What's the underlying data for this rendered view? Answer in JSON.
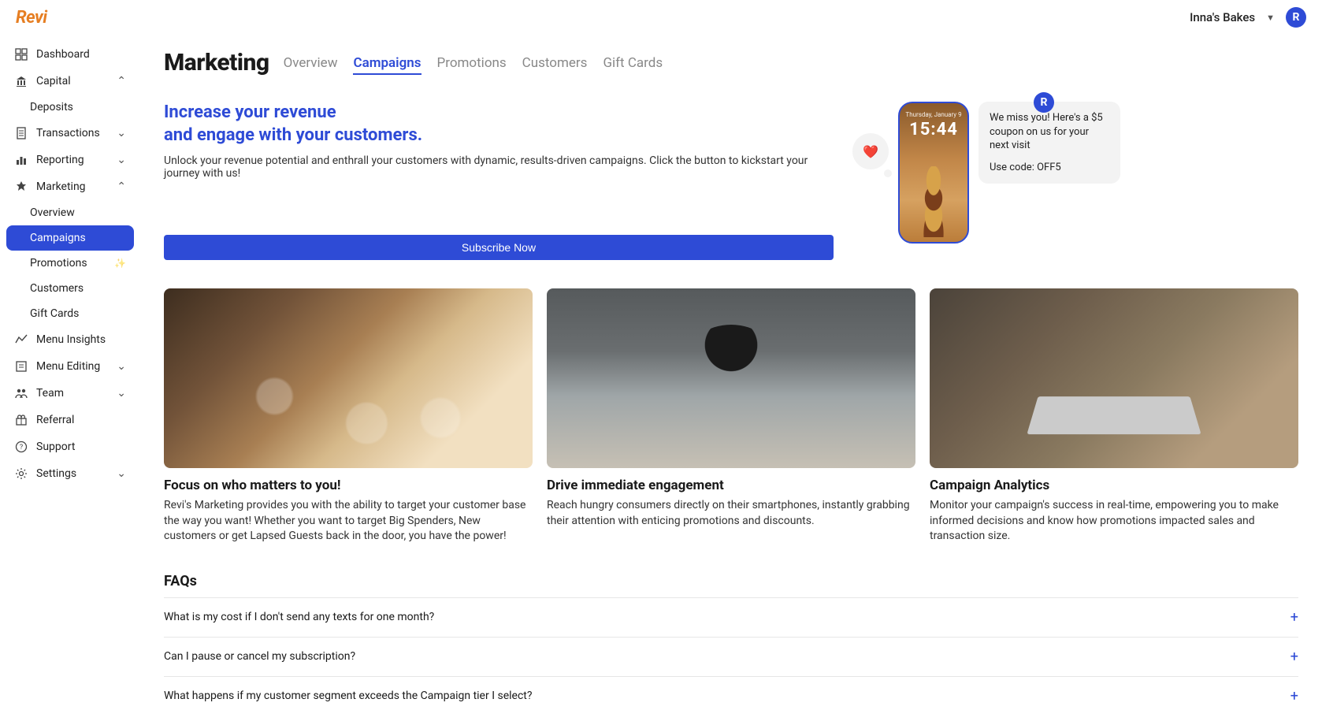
{
  "brand": {
    "name": "Revi"
  },
  "account": {
    "name": "Inna's Bakes",
    "avatar_initial": "R"
  },
  "sidebar": {
    "items": [
      {
        "label": "Dashboard",
        "icon": "dashboard-icon"
      },
      {
        "label": "Capital",
        "icon": "bank-icon",
        "expanded": true,
        "children": [
          {
            "label": "Deposits"
          }
        ]
      },
      {
        "label": "Transactions",
        "icon": "document-icon",
        "expandable": true
      },
      {
        "label": "Reporting",
        "icon": "chart-icon",
        "expandable": true
      },
      {
        "label": "Marketing",
        "icon": "badge-icon",
        "expanded": true,
        "children": [
          {
            "label": "Overview"
          },
          {
            "label": "Campaigns",
            "active": true
          },
          {
            "label": "Promotions",
            "sparkle": true
          },
          {
            "label": "Customers"
          },
          {
            "label": "Gift Cards"
          }
        ]
      },
      {
        "label": "Menu Insights",
        "icon": "insights-icon"
      },
      {
        "label": "Menu Editing",
        "icon": "edit-icon",
        "expandable": true
      },
      {
        "label": "Team",
        "icon": "team-icon",
        "expandable": true
      },
      {
        "label": "Referral",
        "icon": "gift-icon"
      },
      {
        "label": "Support",
        "icon": "help-icon"
      },
      {
        "label": "Settings",
        "icon": "gear-icon",
        "expandable": true
      }
    ]
  },
  "page": {
    "title": "Marketing",
    "tabs": [
      {
        "label": "Overview"
      },
      {
        "label": "Campaigns",
        "active": true
      },
      {
        "label": "Promotions"
      },
      {
        "label": "Customers"
      },
      {
        "label": "Gift Cards"
      }
    ]
  },
  "hero": {
    "title_line1": "Increase your revenue",
    "title_line2": "and engage with your customers.",
    "desc": "Unlock your revenue potential and enthrall your customers with dynamic, results-driven campaigns. Click the button to kickstart your journey with us!",
    "subscribe_label": "Subscribe Now",
    "phone": {
      "day": "Thursday, January 9",
      "time": "15:44"
    },
    "message": {
      "line1": "We miss you! Here's a $5 coupon on us for your next visit",
      "line2": "Use code: OFF5"
    }
  },
  "features": [
    {
      "title": "Focus on who matters to you!",
      "desc": "Revi's Marketing provides you with the ability to target your customer base the way you want! Whether you want to target Big Spenders, New customers or get Lapsed Guests back in the door, you have the power!"
    },
    {
      "title": "Drive immediate engagement",
      "desc": "Reach hungry consumers directly on their smartphones, instantly grabbing their attention with enticing promotions and discounts."
    },
    {
      "title": "Campaign Analytics",
      "desc": "Monitor your campaign's success in real-time, empowering you to make informed decisions and know how promotions impacted sales and transaction size."
    }
  ],
  "faqs": {
    "title": "FAQs",
    "items": [
      {
        "q": "What is my cost if I don't send any texts for one month?"
      },
      {
        "q": "Can I pause or cancel my subscription?"
      },
      {
        "q": "What happens if my customer segment exceeds the Campaign tier I select?"
      }
    ]
  },
  "colors": {
    "primary": "#2e4bd6",
    "brand": "#e67e22"
  }
}
